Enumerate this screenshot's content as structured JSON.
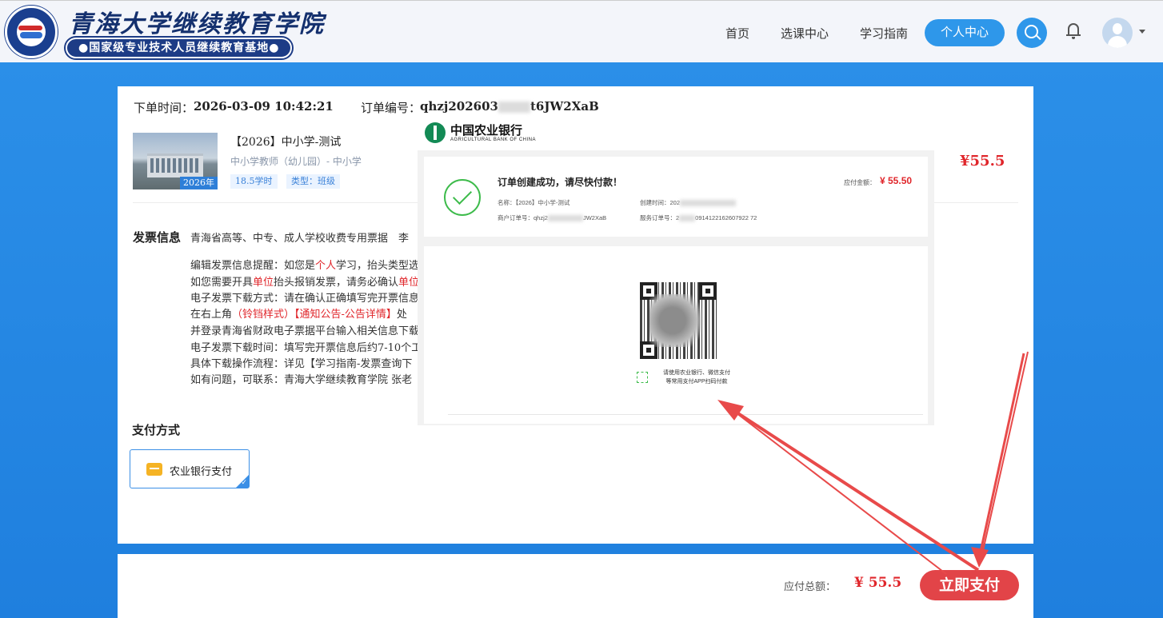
{
  "header": {
    "site_title": "青海大学继续教育学院",
    "site_subtitle": "●国家级专业技术人员继续教育基地●",
    "nav": {
      "home": "首页",
      "course_center": "选课中心",
      "study_guide": "学习指南",
      "personal_center": "个人中心"
    },
    "icons": [
      "search-icon",
      "bell-icon",
      "avatar",
      "chevron-down-icon"
    ],
    "accent_color": "#2e97ea"
  },
  "order": {
    "time_label": "下单时间：",
    "time_value": "2026-03-09 10:42:21",
    "number_label": "订单编号：",
    "number_value_prefix": "qhzj202603",
    "number_value_suffix": "t6JW2XaB"
  },
  "course": {
    "title": "【2026】中小学-测试",
    "meta": "中小学教师（幼儿园）- 中小学",
    "year_tag": "2026年",
    "hours": "18.5学时",
    "type": "类型：班级",
    "price": "¥55.5"
  },
  "invoice": {
    "label": "发票信息",
    "value": "青海省高等、中专、成人学校收费专用票据　李",
    "notes": [
      {
        "pre": "编辑发票信息提醒：如您是",
        "red": "个人",
        "post": "学习，抬头类型选"
      },
      {
        "pre": "如您需要开具",
        "red": "单位",
        "post": "抬头报销发票，请务必确认",
        "red2": "单位"
      },
      {
        "pre": "电子发票下载方式：请在确认正确填写完开票信息",
        "red": "",
        "post": ""
      },
      {
        "pre": "在右上角",
        "red": "（铃铛样式）【通知公告-公告详情】",
        "post": "处"
      },
      {
        "pre": "并登录青海省财政电子票据平台输入相关信息下载",
        "red": "",
        "post": ""
      },
      {
        "pre": "电子发票下载时间：填写完开票信息后约7-10个工",
        "red": "",
        "post": ""
      },
      {
        "pre": "具体下载操作流程：详见【学习指南-发票查询下",
        "red": "",
        "post": ""
      },
      {
        "pre": "如有问题，可联系：青海大学继续教育学院 张老",
        "red": "",
        "post": ""
      }
    ]
  },
  "payment": {
    "method_label": "支付方式",
    "option": "农业银行支付",
    "total_label": "应付总额：",
    "total_value": "¥ 55.5",
    "pay_button": "立即支付"
  },
  "abc": {
    "bank_name": "中国农业银行",
    "bank_name_en": "AGRICULTURAL BANK OF CHINA",
    "success_msg": "订单创建成功，请尽快付款！",
    "amount_label": "应付金额：",
    "amount_value": "¥ 55.50",
    "name_label": "名称：【2026】中小学-测试",
    "merchant_order": "商户订单号：qhzj2",
    "merchant_order_tail": "JW2XaB",
    "created_time": "创建时间：202",
    "service_order": "服务订单号：2",
    "service_order_tail": "0914122162607922 72",
    "scan_line1": "请使用农业银行、微信支付",
    "scan_line2": "等常用支付APP扫码付款",
    "brand_color": "#138a55"
  }
}
